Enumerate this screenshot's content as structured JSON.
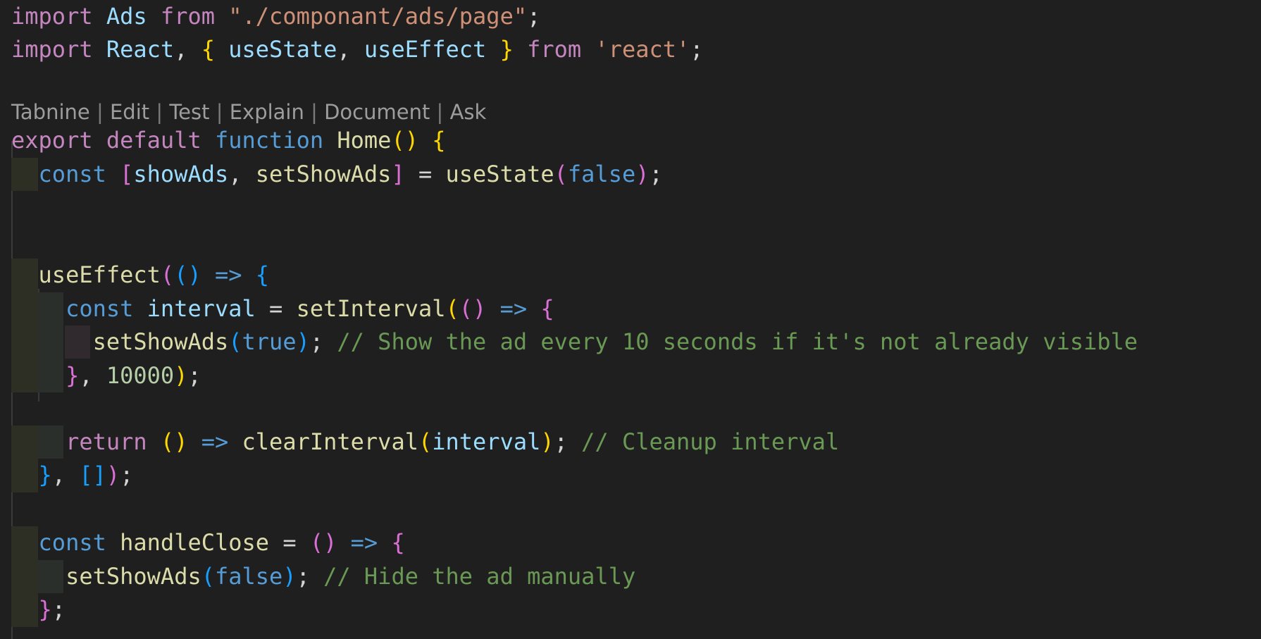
{
  "codelens": {
    "items": [
      "Tabnine",
      "Edit",
      "Test",
      "Explain",
      "Document",
      "Ask"
    ],
    "separator": " | "
  },
  "lines": [
    [
      [
        "kw",
        "import"
      ],
      [
        "p",
        " "
      ],
      [
        "var",
        "Ads"
      ],
      [
        "p",
        " "
      ],
      [
        "kw",
        "from"
      ],
      [
        "p",
        " "
      ],
      [
        "str",
        "\"./componant/ads/page\""
      ],
      [
        "p",
        ";"
      ]
    ],
    [
      [
        "kw",
        "import"
      ],
      [
        "p",
        " "
      ],
      [
        "var",
        "React"
      ],
      [
        "p",
        ", "
      ],
      [
        "b1",
        "{"
      ],
      [
        "p",
        " "
      ],
      [
        "var",
        "useState"
      ],
      [
        "p",
        ", "
      ],
      [
        "var",
        "useEffect"
      ],
      [
        "p",
        " "
      ],
      [
        "b1",
        "}"
      ],
      [
        "p",
        " "
      ],
      [
        "kw",
        "from"
      ],
      [
        "p",
        " "
      ],
      [
        "str",
        "'react'"
      ],
      [
        "p",
        ";"
      ]
    ],
    [],
    [
      [
        "kw",
        "export"
      ],
      [
        "p",
        " "
      ],
      [
        "kw",
        "default"
      ],
      [
        "p",
        " "
      ],
      [
        "st",
        "function"
      ],
      [
        "p",
        " "
      ],
      [
        "fn",
        "Home"
      ],
      [
        "b1",
        "()"
      ],
      [
        "p",
        " "
      ],
      [
        "b1",
        "{"
      ]
    ],
    [
      [
        "p",
        "  "
      ],
      [
        "st",
        "const"
      ],
      [
        "p",
        " "
      ],
      [
        "b2",
        "["
      ],
      [
        "var",
        "showAds"
      ],
      [
        "p",
        ", "
      ],
      [
        "fn",
        "setShowAds"
      ],
      [
        "b2",
        "]"
      ],
      [
        "p",
        " = "
      ],
      [
        "fn",
        "useState"
      ],
      [
        "b2",
        "("
      ],
      [
        "st",
        "false"
      ],
      [
        "b2",
        ")"
      ],
      [
        "p",
        ";"
      ]
    ],
    [],
    [],
    [
      [
        "p",
        "  "
      ],
      [
        "fn",
        "useEffect"
      ],
      [
        "b2",
        "("
      ],
      [
        "b3",
        "()"
      ],
      [
        "p",
        " "
      ],
      [
        "st",
        "=>"
      ],
      [
        "p",
        " "
      ],
      [
        "b3",
        "{"
      ]
    ],
    [
      [
        "p",
        "    "
      ],
      [
        "st",
        "const"
      ],
      [
        "p",
        " "
      ],
      [
        "var",
        "interval"
      ],
      [
        "p",
        " = "
      ],
      [
        "fn",
        "setInterval"
      ],
      [
        "b1",
        "("
      ],
      [
        "b2",
        "()"
      ],
      [
        "p",
        " "
      ],
      [
        "st",
        "=>"
      ],
      [
        "p",
        " "
      ],
      [
        "b2",
        "{"
      ]
    ],
    [
      [
        "p",
        "      "
      ],
      [
        "fn",
        "setShowAds"
      ],
      [
        "b3",
        "("
      ],
      [
        "st",
        "true"
      ],
      [
        "b3",
        ")"
      ],
      [
        "p",
        "; "
      ],
      [
        "cm",
        "// Show the ad every 10 seconds if it's not already visible"
      ]
    ],
    [
      [
        "p",
        "    "
      ],
      [
        "b2",
        "}"
      ],
      [
        "p",
        ", "
      ],
      [
        "num",
        "10000"
      ],
      [
        "b1",
        ")"
      ],
      [
        "p",
        ";"
      ]
    ],
    [],
    [
      [
        "p",
        "    "
      ],
      [
        "kw",
        "return"
      ],
      [
        "p",
        " "
      ],
      [
        "b1",
        "()"
      ],
      [
        "p",
        " "
      ],
      [
        "st",
        "=>"
      ],
      [
        "p",
        " "
      ],
      [
        "fn",
        "clearInterval"
      ],
      [
        "b1",
        "("
      ],
      [
        "var",
        "interval"
      ],
      [
        "b1",
        ")"
      ],
      [
        "p",
        "; "
      ],
      [
        "cm",
        "// Cleanup interval"
      ]
    ],
    [
      [
        "p",
        "  "
      ],
      [
        "b3",
        "}"
      ],
      [
        "p",
        ", "
      ],
      [
        "b3",
        "[]"
      ],
      [
        "b2",
        ")"
      ],
      [
        "p",
        ";"
      ]
    ],
    [],
    [
      [
        "p",
        "  "
      ],
      [
        "st",
        "const"
      ],
      [
        "p",
        " "
      ],
      [
        "fn",
        "handleClose"
      ],
      [
        "p",
        " = "
      ],
      [
        "b2",
        "()"
      ],
      [
        "p",
        " "
      ],
      [
        "st",
        "=>"
      ],
      [
        "p",
        " "
      ],
      [
        "b2",
        "{"
      ]
    ],
    [
      [
        "p",
        "    "
      ],
      [
        "fn",
        "setShowAds"
      ],
      [
        "b3",
        "("
      ],
      [
        "st",
        "false"
      ],
      [
        "b3",
        ")"
      ],
      [
        "p",
        "; "
      ],
      [
        "cm",
        "// Hide the ad manually"
      ]
    ],
    [
      [
        "p",
        "  "
      ],
      [
        "b2",
        "}"
      ],
      [
        "p",
        ";"
      ]
    ]
  ]
}
